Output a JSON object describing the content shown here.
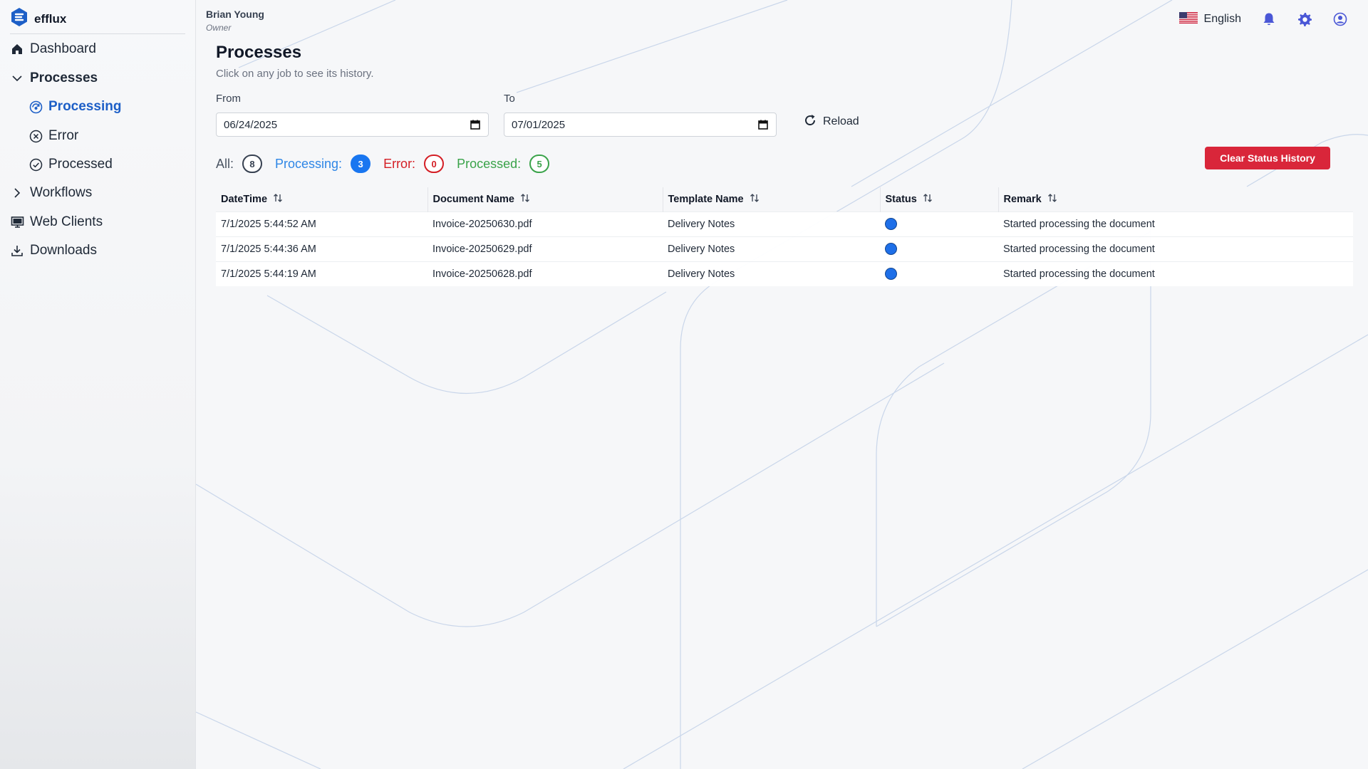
{
  "app": {
    "name": "efflux"
  },
  "colors": {
    "accent": "#1d5fc7",
    "processing": "#1976f0",
    "error": "#d41e25",
    "processed": "#3aa34a",
    "danger_button": "#d9263a"
  },
  "sidebar": {
    "items": [
      {
        "label": "Dashboard",
        "icon": "home-icon"
      },
      {
        "label": "Processes",
        "icon": "chevron-down-icon",
        "expanded": true
      },
      {
        "label": "Processing",
        "icon": "processing-icon",
        "active": true
      },
      {
        "label": "Error",
        "icon": "error-circle-icon"
      },
      {
        "label": "Processed",
        "icon": "check-circle-icon"
      },
      {
        "label": "Workflows",
        "icon": "chevron-right-icon"
      },
      {
        "label": "Web Clients",
        "icon": "monitor-icon"
      },
      {
        "label": "Downloads",
        "icon": "download-icon"
      }
    ]
  },
  "user": {
    "name": "Brian Young",
    "role": "Owner"
  },
  "topbar": {
    "language": "English"
  },
  "page": {
    "title": "Processes",
    "subtitle": "Click on any job to see its history."
  },
  "filters_form": {
    "from_label": "From",
    "from_value": "06/24/2025",
    "to_label": "To",
    "to_value": "07/01/2025",
    "reload_label": "Reload"
  },
  "status_filters": {
    "all": {
      "label": "All:",
      "count": "8"
    },
    "processing": {
      "label": "Processing:",
      "count": "3"
    },
    "error": {
      "label": "Error:",
      "count": "0"
    },
    "processed": {
      "label": "Processed:",
      "count": "5"
    }
  },
  "clear_button": "Clear Status History",
  "table": {
    "columns": [
      "DateTime",
      "Document Name",
      "Template Name",
      "Status",
      "Remark"
    ],
    "rows": [
      {
        "datetime": "7/1/2025 5:44:52 AM",
        "document": "Invoice-20250630.pdf",
        "template": "Delivery Notes",
        "status": "processing",
        "remark": "Started processing the document"
      },
      {
        "datetime": "7/1/2025 5:44:36 AM",
        "document": "Invoice-20250629.pdf",
        "template": "Delivery Notes",
        "status": "processing",
        "remark": "Started processing the document"
      },
      {
        "datetime": "7/1/2025 5:44:19 AM",
        "document": "Invoice-20250628.pdf",
        "template": "Delivery Notes",
        "status": "processing",
        "remark": "Started processing the document"
      }
    ]
  }
}
